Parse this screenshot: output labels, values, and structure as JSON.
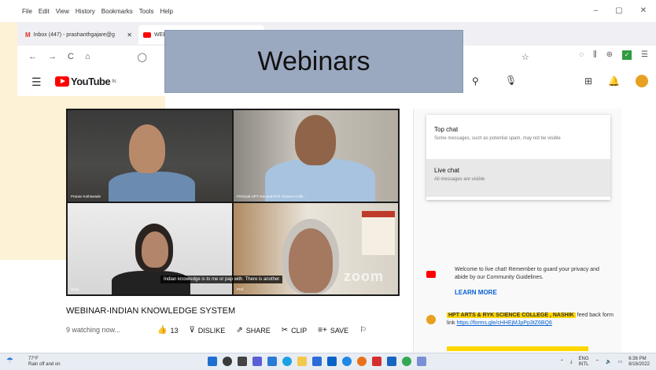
{
  "menubar": {
    "items": [
      "File",
      "Edit",
      "View",
      "History",
      "Bookmarks",
      "Tools",
      "Help"
    ]
  },
  "window": {
    "minimize": "–",
    "maximize": "▢",
    "close": "✕"
  },
  "tabs": [
    {
      "label": "Inbox (447) - prashanthgajare@g",
      "close": "✕"
    },
    {
      "label": "WEB"
    }
  ],
  "nav": {
    "back": "←",
    "forward": "→",
    "reload": "C",
    "home": "⌂",
    "shield": "◯",
    "lock": "🔒",
    "bookmark": "☆"
  },
  "youtube": {
    "logo_text": "YouTube",
    "logo_sup": "IN"
  },
  "overlay": {
    "title": "Webinars"
  },
  "video": {
    "tile_labels": [
      "Pranav Kothawade",
      "Principal HPT Arts and RYK Science Colle...",
      "Surja",
      "Prof"
    ],
    "caption": "Indian knowledge is to me or pap with. There is another",
    "watermark": "zoom"
  },
  "video_info": {
    "title": "WEBINAR-INDIAN KNOWLEDGE SYSTEM",
    "watching": "9 watching now...",
    "likes": "13",
    "dislike": "DISLIKE",
    "share": "SHARE",
    "clip": "CLIP",
    "save": "SAVE"
  },
  "chat": {
    "options": [
      {
        "title": "Top chat",
        "sub": "Some messages, such as potential spam, may not be visible"
      },
      {
        "title": "Live chat",
        "sub": "All messages are visible"
      }
    ],
    "welcome": "Welcome to live chat! Remember to guard your privacy and abide by our Community Guidelines.",
    "learn_more": "LEARN MORE",
    "message": {
      "author": "HPT ARTS & RYK SCIENCE COLLEGE , NASHIK",
      "text": "feed back form link",
      "link": "https://forms.gle/cHHEjMJpPp3tZ6BQ6"
    }
  },
  "taskbar": {
    "weather_temp": "77°F",
    "weather_desc": "Rain off and on",
    "lang": "ENG",
    "lang_sub": "INTL",
    "time": "6:36 PM",
    "date": "8/16/2022"
  }
}
